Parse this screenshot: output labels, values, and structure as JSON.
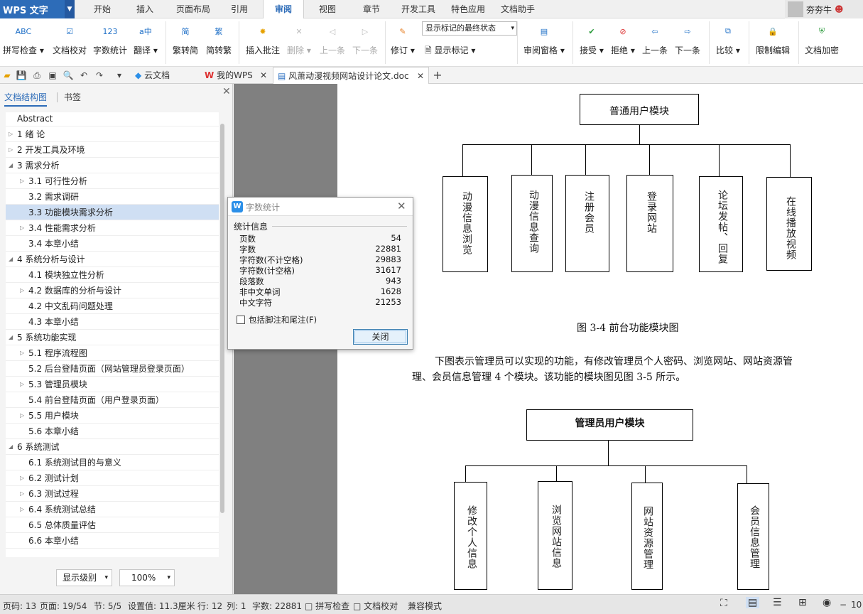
{
  "app": {
    "brand": "WPS 文字",
    "user_name": "夯夯牛"
  },
  "menu": {
    "tabs": [
      "开始",
      "插入",
      "页面布局",
      "引用",
      "审阅",
      "视图",
      "章节",
      "开发工具",
      "特色应用",
      "文档助手"
    ],
    "active": "审阅"
  },
  "toolbar": {
    "spell_check": "拼写检查",
    "doc_proof": "文档校对",
    "word_count": "字数统计",
    "translate": "翻译",
    "trad_to_simp": "繁转简",
    "simp_to_trad": "简转繁",
    "insert_comment": "插入批注",
    "delete": "删除",
    "prev": "上一条",
    "next": "下一条",
    "revise": "修订",
    "markup_state": "显示标记的最终状态",
    "show_markup": "显示标记",
    "review_pane": "审阅窗格",
    "accept": "接受",
    "reject": "拒绝",
    "prev2": "上一条",
    "next2": "下一条",
    "compare": "比较",
    "restrict_edit": "限制编辑",
    "encrypt": "文档加密",
    "icon_abc": "ABC",
    "icon_123": "123",
    "icon_trad": "简",
    "icon_simp": "繁"
  },
  "doctabs": {
    "cloud": "云文档",
    "mywps": "我的WPS",
    "document": "风萧动漫视频网站设计论文.doc"
  },
  "nav": {
    "tab_toc": "文档结构图",
    "tab_bookmarks": "书签",
    "items": [
      {
        "label": "Abstract"
      },
      {
        "label": "1   绪   论"
      },
      {
        "label": "2   开发工具及环境"
      },
      {
        "label": "3   需求分析"
      },
      {
        "label": "3.1 可行性分析"
      },
      {
        "label": "3.2 需求调研"
      },
      {
        "label": "3.3 功能模块需求分析"
      },
      {
        "label": "3.4 性能需求分析"
      },
      {
        "label": "3.4 本章小结"
      },
      {
        "label": "4   系统分析与设计"
      },
      {
        "label": "4.1 模块独立性分析"
      },
      {
        "label": "4.2 数据库的分析与设计"
      },
      {
        "label": "4.2 中文乱码问题处理"
      },
      {
        "label": "4.3 本章小结"
      },
      {
        "label": "5   系统功能实现"
      },
      {
        "label": "5.1 程序流程图"
      },
      {
        "label": "5.2 后台登陆页面（网站管理员登录页面）"
      },
      {
        "label": "5.3 管理员模块"
      },
      {
        "label": "5.4 前台登陆页面（用户登录页面）"
      },
      {
        "label": "5.5 用户模块"
      },
      {
        "label": "5.6 本章小结"
      },
      {
        "label": "6   系统测试"
      },
      {
        "label": "6.1   系统测试目的与意义"
      },
      {
        "label": "6.2   测试计划"
      },
      {
        "label": "6.3   测试过程"
      },
      {
        "label": "6.4   系统测试总结"
      },
      {
        "label": "6.5   总体质量评估"
      },
      {
        "label": "6.6   本章小结"
      }
    ],
    "level_button": "显示级别",
    "zoom_value": "100%"
  },
  "document": {
    "diagram1": {
      "root": "普通用户模块",
      "children": [
        "动漫信息浏览",
        "动漫信息查询",
        "注册会员",
        "登录网站",
        "论坛发帖、回复",
        "在线播放视频"
      ],
      "caption": "图 3-4 前台功能模块图"
    },
    "paragraph_line1": "下图表示管理员可以实现的功能，有修改管理员个人密码、浏览网站、网站资源管",
    "paragraph_line2": "理、会员信息管理 4 个模块。该功能的模块图见图 3-5 所示。",
    "diagram2": {
      "root": "管理员用户模块",
      "children": [
        "修改个人信息",
        "浏览网站信息",
        "网站资源管理",
        "会员信息管理"
      ]
    }
  },
  "dialog": {
    "title": "字数统计",
    "section": "统计信息",
    "stats": [
      {
        "label": "页数",
        "value": "54"
      },
      {
        "label": "字数",
        "value": "22881"
      },
      {
        "label": "字符数(不计空格)",
        "value": "29883"
      },
      {
        "label": "字符数(计空格)",
        "value": "31617"
      },
      {
        "label": "段落数",
        "value": "943"
      },
      {
        "label": "非中文单词",
        "value": "1628"
      },
      {
        "label": "中文字符",
        "value": "21253"
      }
    ],
    "include_notes": "包括脚注和尾注(F)",
    "close_button": "关闭"
  },
  "status": {
    "page_code": "页码: 13",
    "page": "页面: 19/54",
    "section": "节: 5/5",
    "setting": "设置值: 11.3厘米",
    "row": "行: 12",
    "col": "列: 1",
    "words": "字数: 22881",
    "spell": "拼写检查",
    "proof": "文档校对",
    "mode": "兼容模式",
    "zoom": "10"
  }
}
